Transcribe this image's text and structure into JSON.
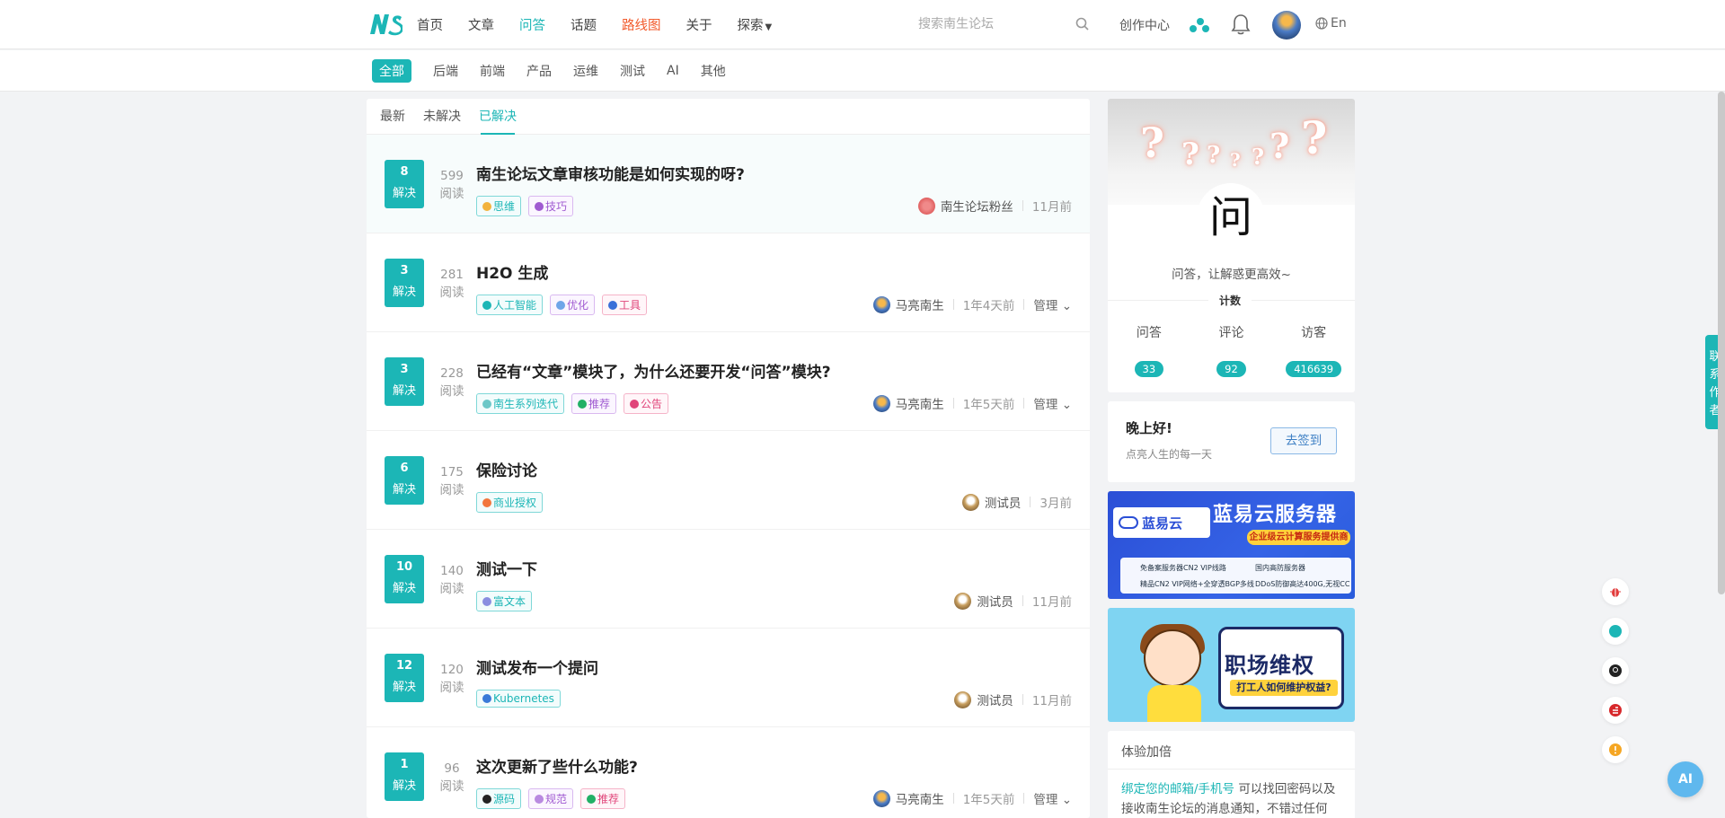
{
  "header": {
    "nav": [
      {
        "label": "首页"
      },
      {
        "label": "文章"
      },
      {
        "label": "问答"
      },
      {
        "label": "话题"
      },
      {
        "label": "路线图"
      },
      {
        "label": "关于"
      },
      {
        "label": "探索"
      }
    ],
    "search_placeholder": "搜索南生论坛",
    "creator_center": "创作中心",
    "language": "En"
  },
  "categories": [
    "全部",
    "后端",
    "前端",
    "产品",
    "运维",
    "测试",
    "AI",
    "其他"
  ],
  "tabs": [
    "最新",
    "未解决",
    "已解决"
  ],
  "questions": [
    {
      "count": "8",
      "status": "解决",
      "reads": "599",
      "reads_label": "阅读",
      "title": "南生论坛文章审核功能是如何实现的呀?",
      "tags": [
        {
          "label": "思维",
          "style": "teal"
        },
        {
          "label": "技巧",
          "style": "purple"
        }
      ],
      "author": "南生论坛粉丝",
      "time": "11月前"
    },
    {
      "count": "3",
      "status": "解决",
      "reads": "281",
      "reads_label": "阅读",
      "title": "H2O 生成",
      "tags": [
        {
          "label": "人工智能",
          "style": "teal"
        },
        {
          "label": "优化",
          "style": "purple"
        },
        {
          "label": "工具",
          "style": "pink"
        }
      ],
      "author": "马亮南生",
      "time": "1年4天前",
      "manage": "管理"
    },
    {
      "count": "3",
      "status": "解决",
      "reads": "228",
      "reads_label": "阅读",
      "title": "已经有“文章”模块了，为什么还要开发“问答”模块?",
      "tags": [
        {
          "label": "南生系列迭代",
          "style": "teal"
        },
        {
          "label": "推荐",
          "style": "purple"
        },
        {
          "label": "公告",
          "style": "pink"
        }
      ],
      "author": "马亮南生",
      "time": "1年5天前",
      "manage": "管理"
    },
    {
      "count": "6",
      "status": "解决",
      "reads": "175",
      "reads_label": "阅读",
      "title": "保险讨论",
      "tags": [
        {
          "label": "商业授权",
          "style": "teal"
        }
      ],
      "author": "测试员",
      "time": "3月前"
    },
    {
      "count": "10",
      "status": "解决",
      "reads": "140",
      "reads_label": "阅读",
      "title": "测试一下",
      "tags": [
        {
          "label": "富文本",
          "style": "teal"
        }
      ],
      "author": "测试员",
      "time": "11月前"
    },
    {
      "count": "12",
      "status": "解决",
      "reads": "120",
      "reads_label": "阅读",
      "title": "测试发布一个提问",
      "tags": [
        {
          "label": "Kubernetes",
          "style": "teal"
        }
      ],
      "author": "测试员",
      "time": "11月前"
    },
    {
      "count": "1",
      "status": "解决",
      "reads": "96",
      "reads_label": "阅读",
      "title": "这次更新了些什么功能?",
      "tags": [
        {
          "label": "源码",
          "style": "teal"
        },
        {
          "label": "规范",
          "style": "purple"
        },
        {
          "label": "推荐",
          "style": "pink"
        }
      ],
      "author": "马亮南生",
      "time": "1年5天前",
      "manage": "管理"
    }
  ],
  "sidebar": {
    "qa_char": "问",
    "qa_slogan": "问答，让解惑更高效~",
    "count_label": "计数",
    "stats": [
      {
        "label": "问答",
        "value": "33"
      },
      {
        "label": "评论",
        "value": "92"
      },
      {
        "label": "访客",
        "value": "416639"
      }
    ],
    "greeting": "晚上好!",
    "greeting_sub": "点亮人生的每一天",
    "checkin": "去签到",
    "ad1": {
      "brand": "蓝易云",
      "title": "蓝易云服务器",
      "sub": "企业级云计算服务提供商",
      "lines": [
        "免备案服务器CN2 VIP线路",
        "国内高防服务器",
        "精品CN2 VIP网络+全穿透BGP多线",
        "DDoS防御高达400G,无视CC"
      ]
    },
    "ad2": {
      "title": "职场维权",
      "sub": "打工人如何维护权益?"
    },
    "bonus_title": "体验加倍",
    "bonus_link": "绑定您的邮箱/手机号",
    "bonus_text": "可以找回密码以及接收南生论坛的消息通知，不错过任何"
  },
  "contact_author": "联系作者",
  "ai_label": "AI",
  "colors": {
    "accent": "#1cb6b6",
    "roadmap": "#f25a2c"
  }
}
